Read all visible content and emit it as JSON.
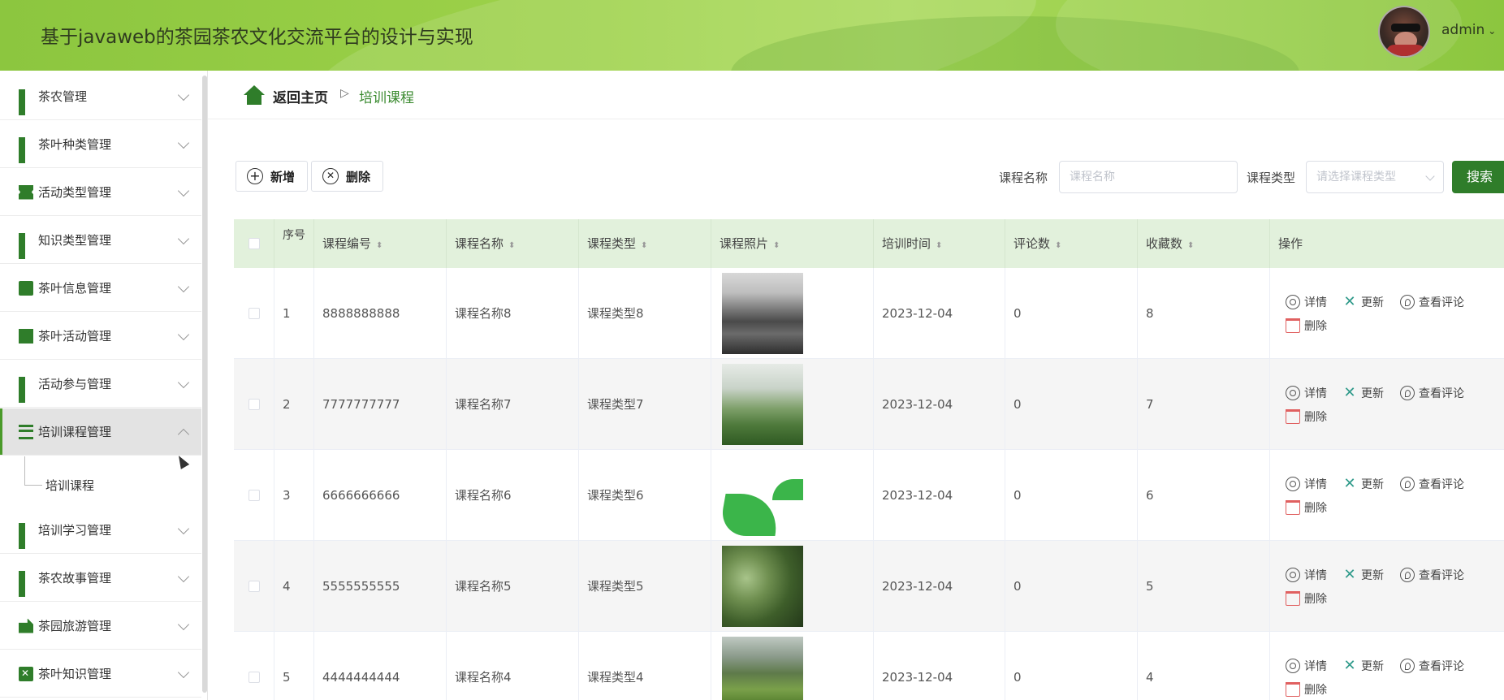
{
  "header": {
    "title": "基于javaweb的茶园茶农文化交流平台的设计与实现",
    "user": "admin"
  },
  "sidebar": {
    "items": [
      {
        "label": "茶农管理",
        "icon": "grid-icon"
      },
      {
        "label": "茶叶种类管理",
        "icon": "grid-icon"
      },
      {
        "label": "活动类型管理",
        "icon": "ticket-icon"
      },
      {
        "label": "知识类型管理",
        "icon": "grid-icon"
      },
      {
        "label": "茶叶信息管理",
        "icon": "chat-icon"
      },
      {
        "label": "茶叶活动管理",
        "icon": "chart-icon"
      },
      {
        "label": "活动参与管理",
        "icon": "grid-icon"
      },
      {
        "label": "培训课程管理",
        "icon": "list-icon"
      },
      {
        "label": "培训学习管理",
        "icon": "grid-icon"
      },
      {
        "label": "茶农故事管理",
        "icon": "grid-icon"
      },
      {
        "label": "茶园旅游管理",
        "icon": "flag-icon"
      },
      {
        "label": "茶叶知识管理",
        "icon": "clipboard-icon"
      }
    ],
    "sub_item": "培训课程"
  },
  "breadcrumb": {
    "home": "返回主页",
    "current": "培训课程"
  },
  "toolbar": {
    "add": "新增",
    "delete": "删除",
    "name_label": "课程名称",
    "name_placeholder": "课程名称",
    "type_label": "课程类型",
    "type_placeholder": "请选择课程类型",
    "search": "搜索"
  },
  "table": {
    "headers": [
      "序号",
      "课程编号",
      "课程名称",
      "课程类型",
      "课程照片",
      "培训时间",
      "评论数",
      "收藏数",
      "操作"
    ],
    "actions": {
      "detail": "详情",
      "update": "更新",
      "comments": "查看评论",
      "delete": "删除"
    },
    "rows": [
      {
        "idx": "1",
        "code": "8888888888",
        "name": "课程名称8",
        "type": "课程类型8",
        "time": "2023-12-04",
        "comments": "0",
        "favs": "8"
      },
      {
        "idx": "2",
        "code": "7777777777",
        "name": "课程名称7",
        "type": "课程类型7",
        "time": "2023-12-04",
        "comments": "0",
        "favs": "7"
      },
      {
        "idx": "3",
        "code": "6666666666",
        "name": "课程名称6",
        "type": "课程类型6",
        "time": "2023-12-04",
        "comments": "0",
        "favs": "6"
      },
      {
        "idx": "4",
        "code": "5555555555",
        "name": "课程名称5",
        "type": "课程类型5",
        "time": "2023-12-04",
        "comments": "0",
        "favs": "5"
      },
      {
        "idx": "5",
        "code": "4444444444",
        "name": "课程名称4",
        "type": "课程类型4",
        "time": "2023-12-04",
        "comments": "0",
        "favs": "4"
      }
    ]
  },
  "colors": {
    "brand": "#2f7d2a",
    "header": "#9ed24a",
    "table_head": "#e2f1dc"
  }
}
